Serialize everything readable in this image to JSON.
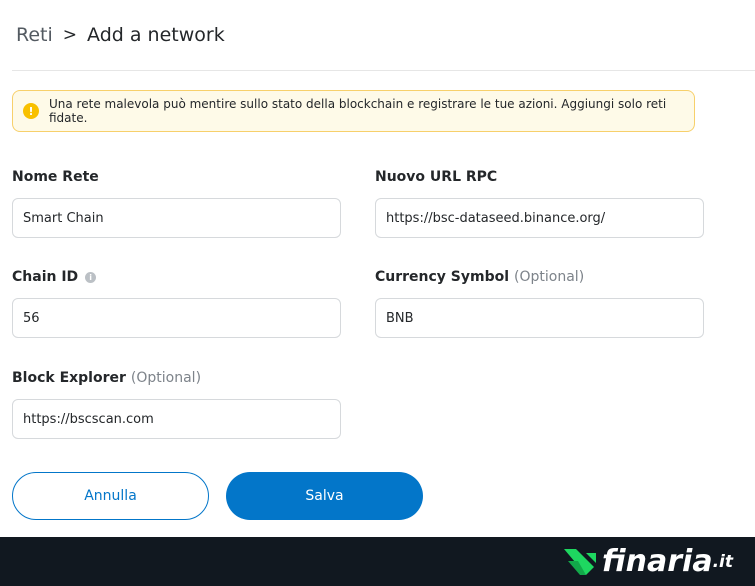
{
  "breadcrumb": {
    "root": "Reti",
    "separator": ">",
    "current": "Add a network"
  },
  "warning": {
    "icon": "warning-icon",
    "text": "Una rete malevola può mentire sullo stato della blockchain e registrare le tue azioni. Aggiungi solo reti fidate."
  },
  "form": {
    "network_name": {
      "label": "Nome Rete",
      "value": "Smart Chain"
    },
    "rpc_url": {
      "label": "Nuovo URL RPC",
      "value": "https://bsc-dataseed.binance.org/"
    },
    "chain_id": {
      "label": "Chain ID",
      "info_icon": "info-icon",
      "value": "56"
    },
    "currency_symbol": {
      "label": "Currency Symbol",
      "optional": "(Optional)",
      "value": "BNB"
    },
    "block_explorer": {
      "label": "Block Explorer",
      "optional": "(Optional)",
      "value": "https://bscscan.com"
    }
  },
  "buttons": {
    "cancel": "Annulla",
    "save": "Salva"
  },
  "footer": {
    "logo_text": "finaria",
    "logo_tld": ".it"
  },
  "colors": {
    "primary": "#0376c9",
    "warning_bg": "#fefae8",
    "warning_border": "#f7d06b",
    "warning_icon": "#f8c000",
    "footer_bg": "#111820",
    "logo_green": "#1ed760"
  }
}
